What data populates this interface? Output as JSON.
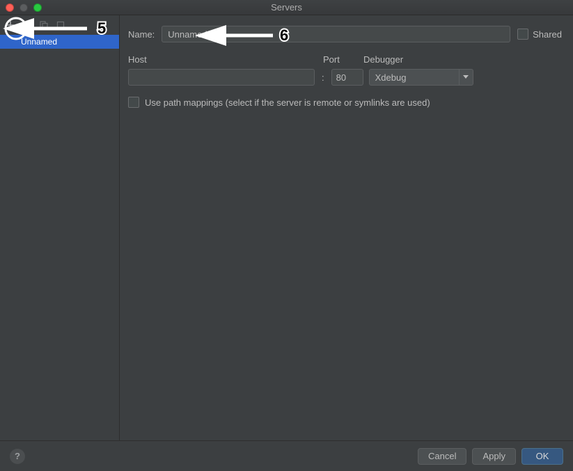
{
  "window": {
    "title": "Servers"
  },
  "sidebar": {
    "items": [
      {
        "label": "Unnamed",
        "selected": true
      }
    ]
  },
  "form": {
    "name_label": "Name:",
    "name_value": "Unnamed",
    "shared_label": "Shared",
    "host_label": "Host",
    "host_value": "",
    "port_label": "Port",
    "port_value": "80",
    "debugger_label": "Debugger",
    "debugger_value": "Xdebug",
    "colon": ":",
    "path_mappings_label": "Use path mappings (select if the server is remote or symlinks are used)"
  },
  "buttons": {
    "cancel": "Cancel",
    "apply": "Apply",
    "ok": "OK",
    "help": "?"
  },
  "annotations": {
    "step5": "5",
    "step6": "6"
  }
}
